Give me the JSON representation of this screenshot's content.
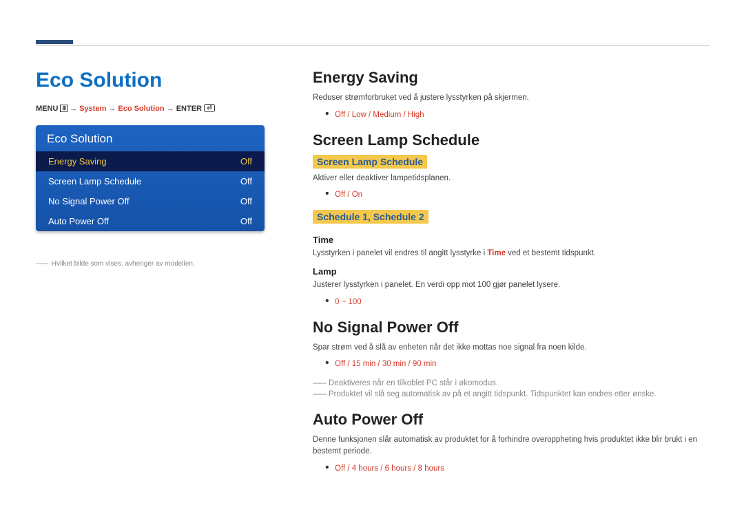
{
  "page_title": "Eco Solution",
  "breadcrumb": {
    "menu_label": "MENU",
    "arrow": "→",
    "system": "System",
    "eco": "Eco Solution",
    "enter": "ENTER"
  },
  "menu_panel": {
    "header": "Eco Solution",
    "rows": [
      {
        "label": "Energy Saving",
        "value": "Off",
        "selected": true
      },
      {
        "label": "Screen Lamp Schedule",
        "value": "Off",
        "selected": false
      },
      {
        "label": "No Signal Power Off",
        "value": "Off",
        "selected": false
      },
      {
        "label": "Auto Power Off",
        "value": "Off",
        "selected": false
      }
    ]
  },
  "caption": "Hvilket bilde som vises, avhenger av modellen.",
  "sections": {
    "energy_saving": {
      "title": "Energy Saving",
      "desc": "Reduser strømforbruket ved å justere lysstyrken på skjermen.",
      "options": "Off / Low / Medium / High"
    },
    "screen_lamp_schedule": {
      "title": "Screen Lamp Schedule",
      "sub1_label": "Screen Lamp Schedule",
      "sub1_desc": "Aktiver eller deaktiver lampetidsplanen.",
      "sub1_options": "Off / On",
      "sub2_label": "Schedule 1, Schedule 2",
      "time_label": "Time",
      "time_desc_pre": "Lysstyrken i panelet vil endres til angitt lysstyrke i ",
      "time_desc_bold": "Time",
      "time_desc_post": " ved et bestemt tidspunkt.",
      "lamp_label": "Lamp",
      "lamp_desc": "Justerer lysstyrken i panelet. En verdi opp mot 100 gjør panelet lysere.",
      "lamp_options": "0 ~ 100"
    },
    "no_signal": {
      "title": "No Signal Power Off",
      "desc": "Spar strøm ved å slå av enheten når det ikke mottas noe signal fra noen kilde.",
      "options": "Off / 15 min / 30 min / 90 min",
      "note1": "Deaktiveres når en tilkoblet PC står i økomodus.",
      "note2": "Produktet vil slå seg automatisk av på et angitt tidspunkt. Tidspunktet kan endres etter ønske."
    },
    "auto_power_off": {
      "title": "Auto Power Off",
      "desc": "Denne funksjonen slår automatisk av produktet for å forhindre overoppheting hvis produktet ikke blir brukt i en bestemt periode.",
      "options": "Off / 4 hours / 6 hours / 8 hours"
    }
  }
}
